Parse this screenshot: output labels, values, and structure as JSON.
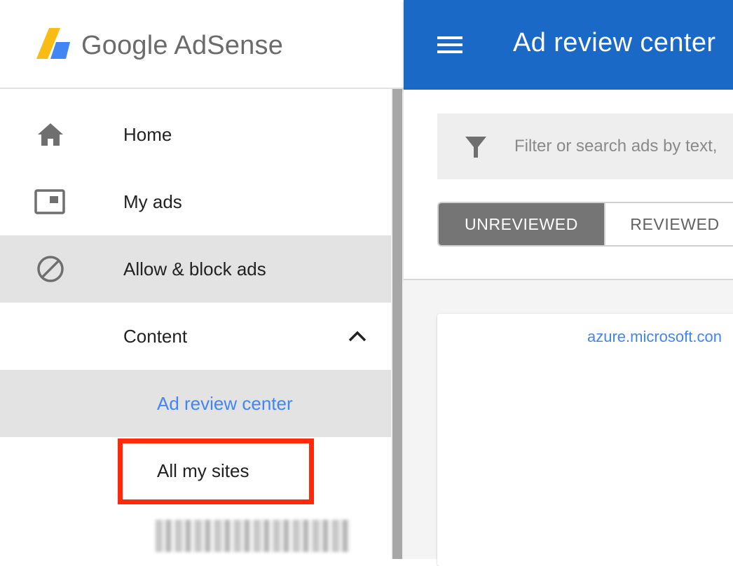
{
  "brand": {
    "name": "Google AdSense"
  },
  "sidebar": {
    "items": [
      {
        "label": "Home",
        "icon": "home-icon"
      },
      {
        "label": "My ads",
        "icon": "ad-unit-icon"
      },
      {
        "label": "Allow & block ads",
        "icon": "block-icon"
      },
      {
        "label": "Content",
        "icon": "chevron-up-icon"
      },
      {
        "label": "Ad review center"
      },
      {
        "label": "All my sites"
      }
    ]
  },
  "topbar": {
    "title": "Ad review center",
    "menu_icon": "menu-icon"
  },
  "filter": {
    "placeholder": "Filter or search ads by text,"
  },
  "tabs": [
    {
      "label": "UNREVIEWED"
    },
    {
      "label": "REVIEWED"
    }
  ],
  "ad_card": {
    "domain": "azure.microsoft.con"
  },
  "colors": {
    "topbar": "#1a69c7",
    "link": "#4285f4",
    "highlight": "#ff2a0a",
    "tab_selected": "#757575"
  }
}
